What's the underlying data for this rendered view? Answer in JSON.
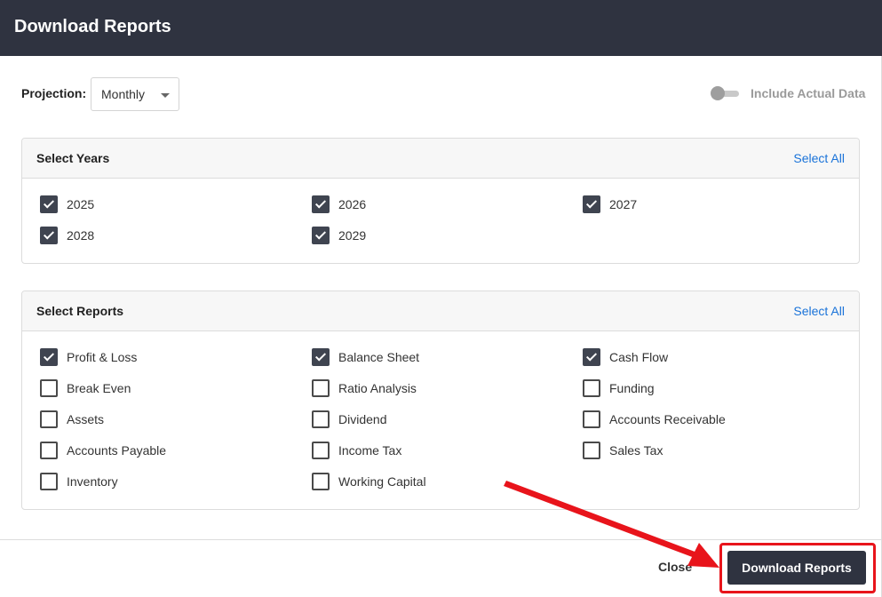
{
  "modal": {
    "title": "Download Reports"
  },
  "projection": {
    "label": "Projection:",
    "value": "Monthly"
  },
  "toggle": {
    "label": "Include Actual Data",
    "on": false
  },
  "years": {
    "title": "Select Years",
    "select_all": "Select All",
    "items": [
      {
        "label": "2025",
        "checked": true
      },
      {
        "label": "2026",
        "checked": true
      },
      {
        "label": "2027",
        "checked": true
      },
      {
        "label": "2028",
        "checked": true
      },
      {
        "label": "2029",
        "checked": true
      }
    ]
  },
  "reports": {
    "title": "Select Reports",
    "select_all": "Select All",
    "items": [
      {
        "label": "Profit & Loss",
        "checked": true
      },
      {
        "label": "Balance Sheet",
        "checked": true
      },
      {
        "label": "Cash Flow",
        "checked": true
      },
      {
        "label": "Break Even",
        "checked": false
      },
      {
        "label": "Ratio Analysis",
        "checked": false
      },
      {
        "label": "Funding",
        "checked": false
      },
      {
        "label": "Assets",
        "checked": false
      },
      {
        "label": "Dividend",
        "checked": false
      },
      {
        "label": "Accounts Receivable",
        "checked": false
      },
      {
        "label": "Accounts Payable",
        "checked": false
      },
      {
        "label": "Income Tax",
        "checked": false
      },
      {
        "label": "Sales Tax",
        "checked": false
      },
      {
        "label": "Inventory",
        "checked": false
      },
      {
        "label": "Working Capital",
        "checked": false
      }
    ]
  },
  "footer": {
    "close_label": "Close",
    "download_label": "Download Reports"
  },
  "colors": {
    "header_bg": "#2f3340",
    "link": "#1a73d9",
    "annotation": "#e8141b"
  }
}
